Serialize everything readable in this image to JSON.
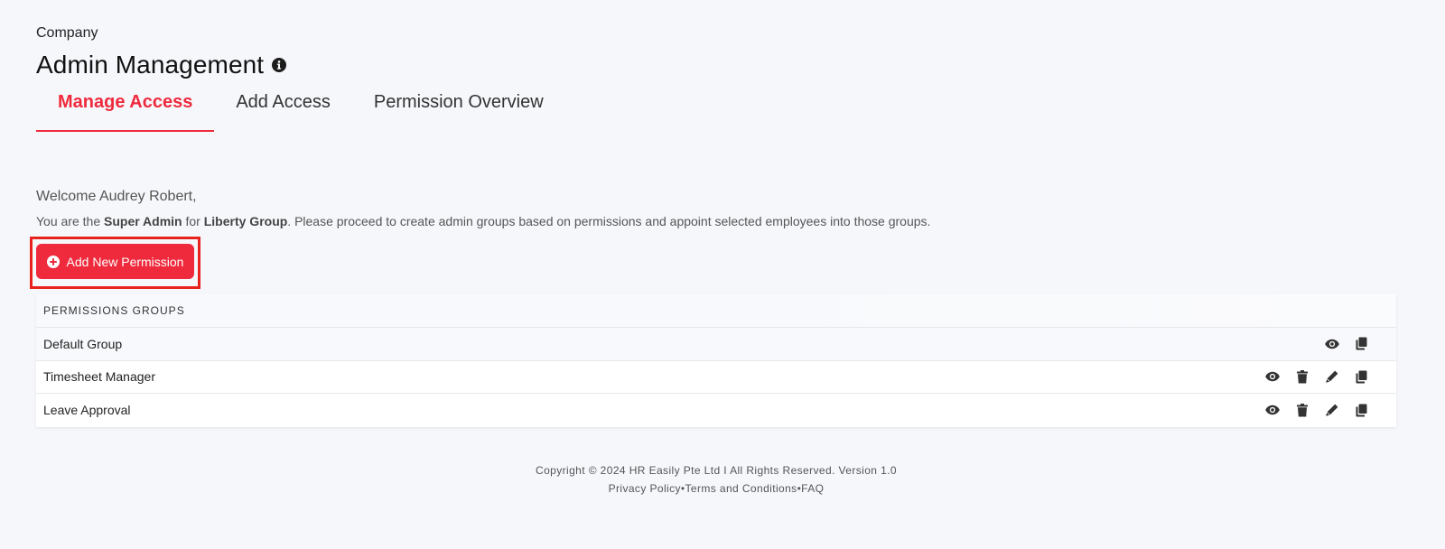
{
  "header": {
    "breadcrumb": "Company",
    "title": "Admin Management"
  },
  "tabs": [
    {
      "label": "Manage Access",
      "active": true
    },
    {
      "label": "Add Access",
      "active": false
    },
    {
      "label": "Permission Overview",
      "active": false
    }
  ],
  "welcome": {
    "greeting": "Welcome Audrey Robert,",
    "intro_prefix": "You are the ",
    "role": "Super Admin",
    "for_text": " for ",
    "company": "Liberty Group",
    "intro_suffix": ". Please proceed to create admin groups based on permissions and appoint selected employees into those groups."
  },
  "add_button": {
    "label": "Add New Permission"
  },
  "table": {
    "header": "PERMISSIONS GROUPS",
    "rows": [
      {
        "name": "Default Group",
        "actions": [
          "view",
          "copy"
        ]
      },
      {
        "name": "Timesheet Manager",
        "actions": [
          "view",
          "delete",
          "edit",
          "copy"
        ]
      },
      {
        "name": "Leave Approval",
        "actions": [
          "view",
          "delete",
          "edit",
          "copy"
        ]
      }
    ]
  },
  "footer": {
    "copyright": "Copyright © 2024 HR Easily Pte Ltd I All Rights Reserved. Version 1.0",
    "privacy": "Privacy Policy",
    "sep": "•",
    "terms": "Terms and Conditions",
    "faq": "FAQ"
  },
  "colors": {
    "accent": "#ef2a3c",
    "highlight_frame": "#e8231d",
    "background": "#f6f7fb"
  },
  "icons": [
    "info-icon",
    "plus-circle-icon",
    "eye-icon",
    "trash-icon",
    "pencil-icon",
    "copy-icon"
  ]
}
